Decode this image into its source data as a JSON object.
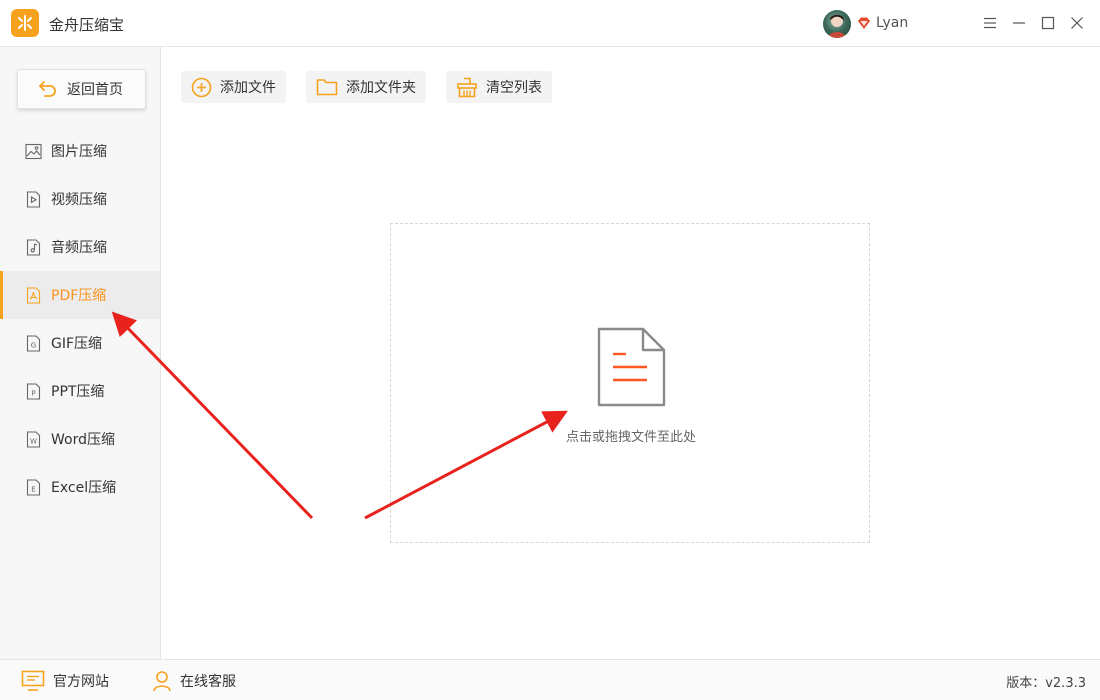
{
  "app": {
    "title": "金舟压缩宝"
  },
  "user": {
    "name": "Lyan"
  },
  "sidebar": {
    "home_label": "返回首页",
    "items": [
      {
        "label": "图片压缩",
        "icon": "image-icon"
      },
      {
        "label": "视频压缩",
        "icon": "video-icon"
      },
      {
        "label": "音频压缩",
        "icon": "audio-icon"
      },
      {
        "label": "PDF压缩",
        "icon": "pdf-icon",
        "active": true
      },
      {
        "label": "GIF压缩",
        "icon": "gif-icon"
      },
      {
        "label": "PPT压缩",
        "icon": "ppt-icon"
      },
      {
        "label": "Word压缩",
        "icon": "word-icon"
      },
      {
        "label": "Excel压缩",
        "icon": "excel-icon"
      }
    ]
  },
  "toolbar": {
    "add_file": "添加文件",
    "add_folder": "添加文件夹",
    "clear_list": "清空列表"
  },
  "dropzone": {
    "hint": "点击或拖拽文件至此处"
  },
  "footer": {
    "website": "官方网站",
    "support": "在线客服",
    "version": "版本：v2.3.3"
  },
  "colors": {
    "accent": "#f7a21c",
    "doc_line": "#ff5722",
    "arrow": "#e8231e"
  }
}
